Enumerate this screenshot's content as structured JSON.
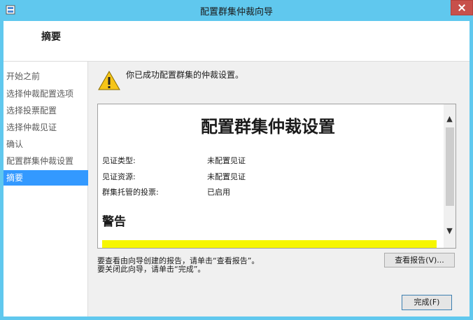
{
  "window": {
    "title": "配置群集仲裁向导"
  },
  "header": {
    "title": "摘要"
  },
  "sidebar": {
    "items": [
      {
        "label": "开始之前",
        "active": false
      },
      {
        "label": "选择仲裁配置选项",
        "active": false
      },
      {
        "label": "选择投票配置",
        "active": false
      },
      {
        "label": "选择仲裁见证",
        "active": false
      },
      {
        "label": "确认",
        "active": false
      },
      {
        "label": "配置群集仲裁设置",
        "active": false
      },
      {
        "label": "摘要",
        "active": true
      }
    ]
  },
  "main": {
    "status_message": "你已成功配置群集的仲裁设置。",
    "report": {
      "heading": "配置群集仲裁设置",
      "rows": [
        {
          "label": "见证类型:",
          "value": "未配置见证"
        },
        {
          "label": "见证资源:",
          "value": "未配置见证"
        },
        {
          "label": "群集托管的投票:",
          "value": "已启用"
        }
      ],
      "warning_heading": "警告"
    },
    "hint_line1": "要查看由向导创建的报告，请单击“查看报告”。",
    "hint_line2": "要关闭此向导，请单击“完成”。",
    "view_report_label": "查看报告(V)...",
    "finish_label": "完成(F)"
  },
  "colors": {
    "titlebar": "#60c8ee",
    "selected_nav": "#3399ff",
    "highlight": "#f6f600",
    "close_button": "#c7504b"
  }
}
